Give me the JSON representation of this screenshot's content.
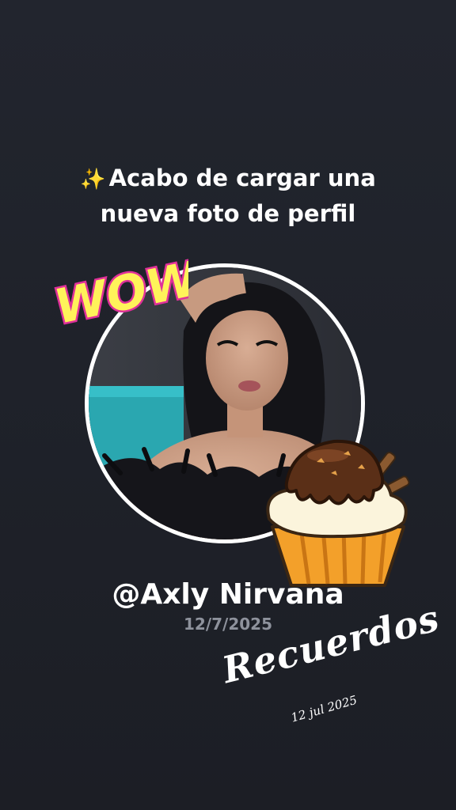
{
  "headline": {
    "icon": "sparkles-icon",
    "icon_glyph": "✨",
    "line1": "Acabo de cargar una",
    "line2": "nueva foto de perfil"
  },
  "profile": {
    "username": "@Axly Nirvana",
    "date": "12/7/2025"
  },
  "stickers": {
    "wow": "WOW!",
    "memories": "Recuerdos",
    "memories_date": "12 jul 2025"
  },
  "colors": {
    "background": "#22252e",
    "ring": "#ffffff",
    "wow_fill": "#fff35a",
    "wow_outline": "#e0309a",
    "date_text": "#8e929c"
  }
}
